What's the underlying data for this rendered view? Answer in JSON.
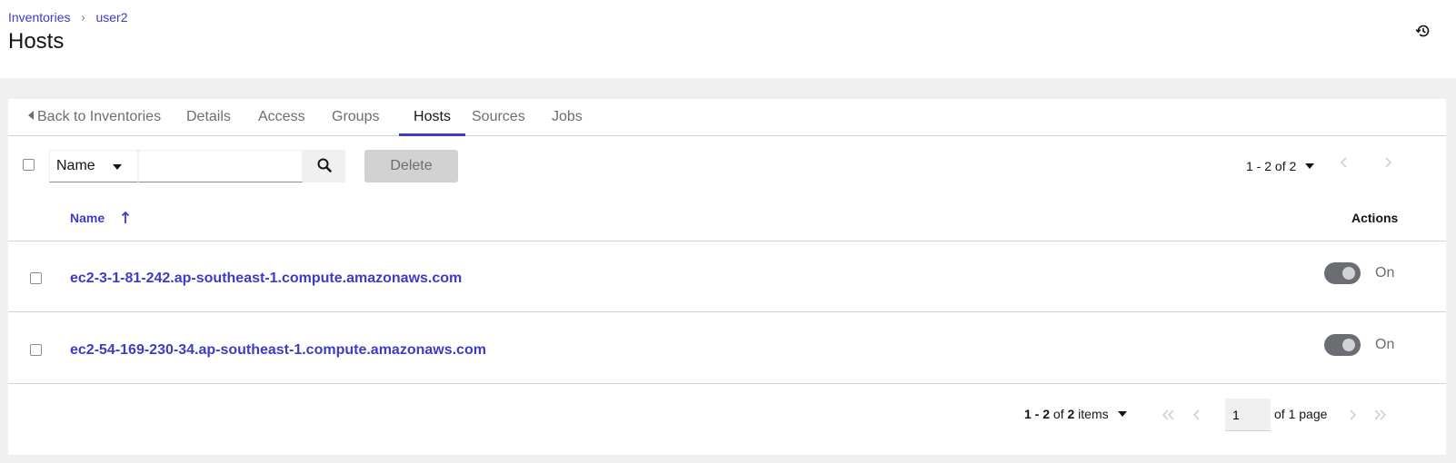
{
  "breadcrumb": {
    "parent": "Inventories",
    "separator": "›",
    "current": "user2"
  },
  "page_title": "Hosts",
  "icons": {
    "history": "history-icon",
    "search": "search-icon",
    "sort": "sort-ascending-icon"
  },
  "tabs": [
    {
      "label": "Back to Inventories",
      "active": false,
      "back": true
    },
    {
      "label": "Details",
      "active": false
    },
    {
      "label": "Access",
      "active": false
    },
    {
      "label": "Groups",
      "active": false
    },
    {
      "label": "Hosts",
      "active": true
    },
    {
      "label": "Sources",
      "active": false
    },
    {
      "label": "Jobs",
      "active": false
    }
  ],
  "toolbar": {
    "filter_value": "Name",
    "search_value": "",
    "delete_label": "Delete",
    "pagination_text": "1 - 2 of 2"
  },
  "table": {
    "columns": {
      "name": "Name",
      "actions": "Actions"
    },
    "rows": [
      {
        "name": "ec2-3-1-81-242.ap-southeast-1.compute.amazonaws.com",
        "enabled": true,
        "toggle_label": "On"
      },
      {
        "name": "ec2-54-169-230-34.ap-southeast-1.compute.amazonaws.com",
        "enabled": true,
        "toggle_label": "On"
      }
    ]
  },
  "footer": {
    "range": "1 - 2",
    "of_word": "of",
    "total": "2",
    "items_word": "items",
    "page_value": "1",
    "of_pages": "of 1 page"
  },
  "colors": {
    "link": "#3c3cc8",
    "active_tab_border": "#3c3cc8",
    "toggle_on": "#6a6e73"
  }
}
